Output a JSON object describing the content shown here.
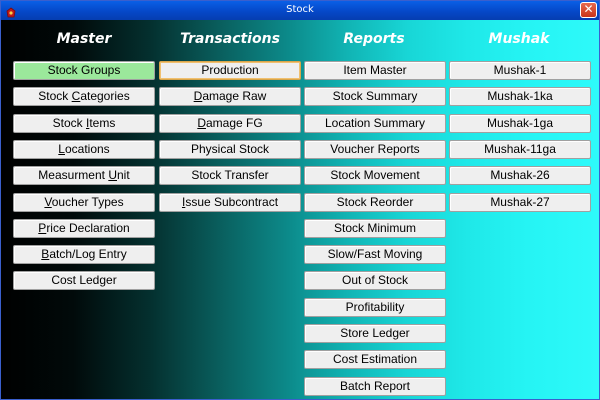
{
  "window": {
    "title": "Stock",
    "close_label": "✕"
  },
  "columns": [
    {
      "header": "Master",
      "buttons": [
        {
          "label": "Stock Groups",
          "state": "selected"
        },
        {
          "label": "Stock Categories"
        },
        {
          "label": "Stock Items"
        },
        {
          "label": "Locations"
        },
        {
          "label": "Measurment Unit"
        },
        {
          "label": "Voucher Types"
        },
        {
          "label": "Price Declaration"
        },
        {
          "label": "Batch/Log Entry"
        },
        {
          "label": "Cost Ledger"
        }
      ]
    },
    {
      "header": "Transactions",
      "buttons": [
        {
          "label": "Production",
          "state": "focused"
        },
        {
          "label": "Damage Raw"
        },
        {
          "label": "Damage FG"
        },
        {
          "label": "Physical Stock"
        },
        {
          "label": "Stock Transfer"
        },
        {
          "label": "Issue Subcontract"
        }
      ]
    },
    {
      "header": "Reports",
      "buttons": [
        {
          "label": "Item Master"
        },
        {
          "label": "Stock Summary"
        },
        {
          "label": "Location Summary"
        },
        {
          "label": "Voucher Reports"
        },
        {
          "label": "Stock Movement"
        },
        {
          "label": "Stock Reorder"
        },
        {
          "label": "Stock Minimum"
        },
        {
          "label": "Slow/Fast Moving"
        },
        {
          "label": "Out of Stock"
        },
        {
          "label": "Profitability"
        },
        {
          "label": "Store Ledger"
        },
        {
          "label": "Cost Estimation"
        },
        {
          "label": "Batch Report"
        }
      ]
    },
    {
      "header": "Mushak",
      "buttons": [
        {
          "label": "Mushak-1"
        },
        {
          "label": "Mushak-1ka"
        },
        {
          "label": "Mushak-1ga"
        },
        {
          "label": "Mushak-11ga"
        },
        {
          "label": "Mushak-26"
        },
        {
          "label": "Mushak-27"
        }
      ]
    }
  ],
  "icons": {
    "app": "stock-app-icon",
    "close": "close-icon"
  },
  "colors": {
    "title_bar": "#0548c8",
    "selected_button": "#9be89b",
    "focused_border": "#d9a54a",
    "header_text": "#ffffff"
  }
}
